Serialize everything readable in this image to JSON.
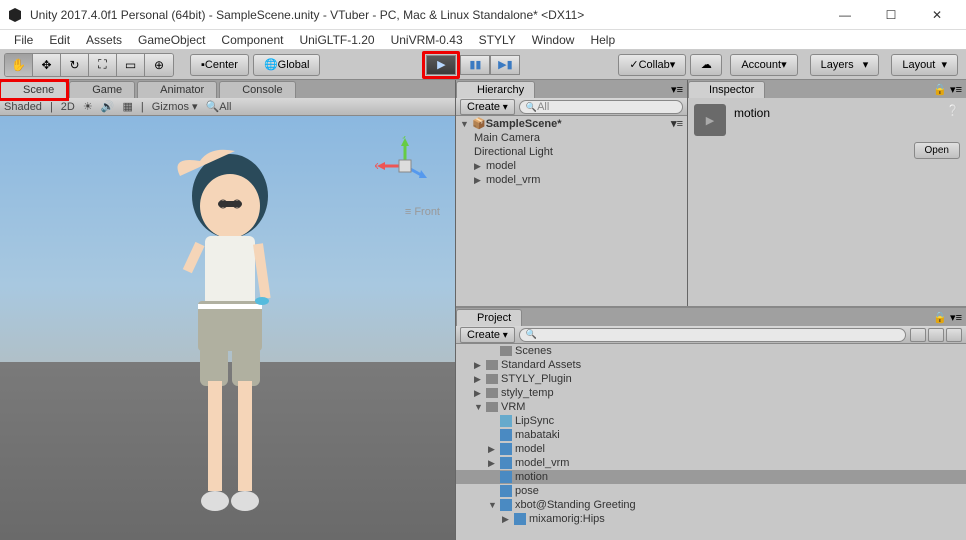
{
  "window": {
    "title": "Unity 2017.4.0f1 Personal (64bit) - SampleScene.unity - VTuber - PC, Mac & Linux Standalone* <DX11>"
  },
  "menu": [
    "File",
    "Edit",
    "Assets",
    "GameObject",
    "Component",
    "UniGLTF-1.20",
    "UniVRM-0.43",
    "STYLY",
    "Window",
    "Help"
  ],
  "toolbar": {
    "center": "Center",
    "global": "Global",
    "collab": "Collab",
    "account": "Account",
    "layers": "Layers",
    "layout": "Layout"
  },
  "tabs": {
    "scene": "Scene",
    "game": "Game",
    "animator": "Animator",
    "console": "Console"
  },
  "scenebar": {
    "shaded": "Shaded",
    "twod": "2D",
    "gizmos": "Gizmos",
    "all": "All"
  },
  "viewport": {
    "axis_x": "x",
    "axis_y": "y",
    "view": "≡ Front"
  },
  "hierarchy": {
    "tab": "Hierarchy",
    "create": "Create",
    "search": "All",
    "scene": "SampleScene*",
    "items": [
      "Main Camera",
      "Directional Light",
      "model",
      "model_vrm"
    ]
  },
  "inspector": {
    "tab": "Inspector",
    "asset": "motion",
    "open": "Open"
  },
  "project": {
    "tab": "Project",
    "create": "Create",
    "items": [
      {
        "label": "Scenes",
        "type": "folder",
        "indent": 2
      },
      {
        "label": "Standard Assets",
        "type": "folder",
        "indent": 1,
        "arrow": "▶"
      },
      {
        "label": "STYLY_Plugin",
        "type": "folder",
        "indent": 1,
        "arrow": "▶"
      },
      {
        "label": "styly_temp",
        "type": "folder",
        "indent": 1,
        "arrow": "▶"
      },
      {
        "label": "VRM",
        "type": "folder",
        "indent": 1,
        "arrow": "▼"
      },
      {
        "label": "LipSync",
        "type": "cyan",
        "indent": 2
      },
      {
        "label": "mabataki",
        "type": "blue",
        "indent": 2
      },
      {
        "label": "model",
        "type": "blue",
        "indent": 2,
        "arrow": "▶"
      },
      {
        "label": "model_vrm",
        "type": "blue",
        "indent": 2,
        "arrow": "▶"
      },
      {
        "label": "motion",
        "type": "blue",
        "indent": 2,
        "sel": true
      },
      {
        "label": "pose",
        "type": "blue",
        "indent": 2
      },
      {
        "label": "xbot@Standing Greeting",
        "type": "blue",
        "indent": 2,
        "arrow": "▼"
      },
      {
        "label": "mixamorig:Hips",
        "type": "blue",
        "indent": 3,
        "arrow": "▶"
      }
    ]
  }
}
